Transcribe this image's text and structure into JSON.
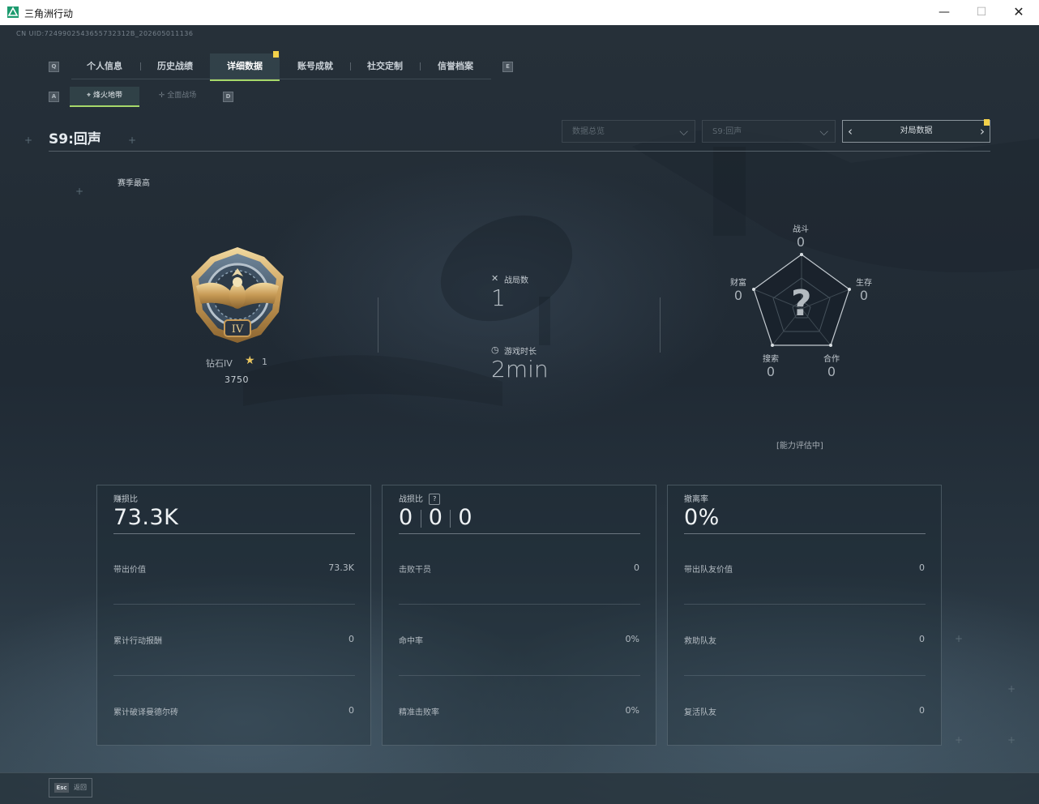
{
  "window": {
    "title": "三角洲行动",
    "minimize": "—",
    "maximize": "☐",
    "close": "✕"
  },
  "uid": "CN UID:7249902543655732312B_202605011136",
  "tabs": {
    "left_key": "Q",
    "right_key": "E",
    "items": [
      {
        "label": "个人信息",
        "active": false
      },
      {
        "label": "历史战绩",
        "active": false
      },
      {
        "label": "详细数据",
        "active": true
      },
      {
        "label": "账号成就",
        "active": false
      },
      {
        "label": "社交定制",
        "active": false
      },
      {
        "label": "信誉档案",
        "active": false
      }
    ]
  },
  "subtabs": {
    "left_key": "A",
    "right_key": "D",
    "items": [
      {
        "label": "烽火地带",
        "icon": "crosshair-icon",
        "active": true
      },
      {
        "label": "全面战场",
        "icon": "target-icon",
        "active": false
      }
    ]
  },
  "season_title": "S9:回声",
  "filters": {
    "data_type": "数据总览",
    "season": "S9:回声",
    "match_button": "对局数据"
  },
  "rank": {
    "section_label": "赛季最高",
    "name": "钻石IV",
    "stars": "1",
    "score": "3750",
    "badge_numeral": "IV"
  },
  "stats": {
    "matches_label": "战局数",
    "matches_value": "1",
    "time_label": "游戏时长",
    "time_value": "2min"
  },
  "radar": {
    "labels": {
      "combat": "战斗",
      "survival": "生存",
      "teamwork": "合作",
      "search": "搜索",
      "wealth": "财富"
    },
    "values": {
      "combat": "0",
      "survival": "0",
      "teamwork": "0",
      "search": "0",
      "wealth": "0"
    },
    "center_mark": "?",
    "status": "[能力评估中]"
  },
  "panels": {
    "profit": {
      "title": "赚损比",
      "big": "73.3K",
      "rows": [
        {
          "label": "带出价值",
          "value": "73.3K"
        },
        {
          "label": "累计行动报酬",
          "value": "0"
        },
        {
          "label": "累计破译曼德尔砖",
          "value": "0"
        }
      ]
    },
    "kd": {
      "title": "战损比",
      "help": "?",
      "big_parts": [
        "0",
        "0",
        "0"
      ],
      "rows": [
        {
          "label": "击败干员",
          "value": "0"
        },
        {
          "label": "命中率",
          "value": "0%"
        },
        {
          "label": "精准击败率",
          "value": "0%"
        }
      ]
    },
    "extract": {
      "title": "撤离率",
      "big": "0%",
      "rows": [
        {
          "label": "带出队友价值",
          "value": "0"
        },
        {
          "label": "救助队友",
          "value": "0"
        },
        {
          "label": "复活队友",
          "value": "0"
        }
      ]
    }
  },
  "footer": {
    "esc_key": "Esc",
    "esc_label": "返回"
  },
  "colors": {
    "accent": "#a6d86a",
    "flag": "#f3d14a"
  }
}
